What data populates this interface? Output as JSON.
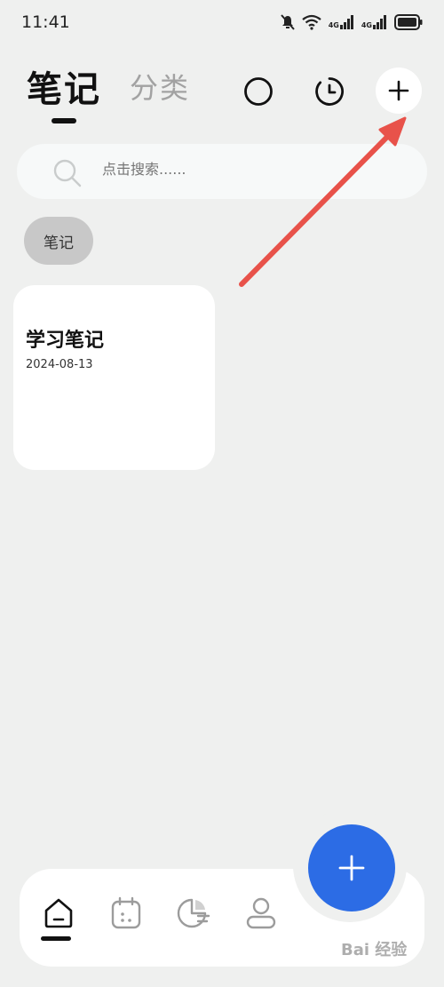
{
  "status_bar": {
    "time": "11:41",
    "network_label_1": "4G",
    "network_label_2": "4G"
  },
  "header": {
    "tab_notes": "笔记",
    "tab_category": "分类"
  },
  "search": {
    "placeholder": "点击搜索......"
  },
  "category_chip": "笔记",
  "notes": [
    {
      "title": "学习笔记",
      "date": "2024-08-13"
    }
  ],
  "colors": {
    "background": "#eff0ef",
    "fab": "#2c6ce5",
    "annotation_arrow": "#e8524a",
    "chip": "#c8c8c8"
  },
  "icons": {
    "header": [
      "circle-icon",
      "clock-icon",
      "plus-icon"
    ],
    "bottom_nav": [
      "home-icon",
      "calendar-icon",
      "stats-icon",
      "profile-icon"
    ]
  },
  "watermark": "Bai 经验"
}
